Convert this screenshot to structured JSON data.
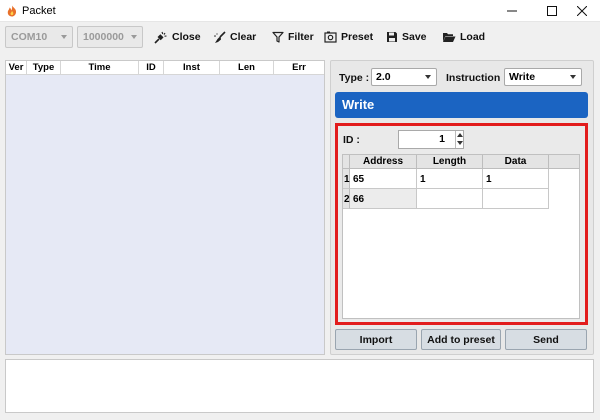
{
  "window": {
    "title": "Packet",
    "accent_color": "#e8702a"
  },
  "toolbar": {
    "port_value": "COM10",
    "baud_value": "1000000",
    "close_label": "Close",
    "clear_label": "Clear",
    "filter_label": "Filter",
    "preset_label": "Preset",
    "save_label": "Save",
    "load_label": "Load"
  },
  "packet_list": {
    "columns": [
      "Ver",
      "Type",
      "Time",
      "ID",
      "Inst",
      "Len",
      "Err"
    ],
    "background": "#e6e9f5"
  },
  "panel": {
    "type_label": "Type :",
    "type_value": "2.0",
    "instruction_label": "Instruction :",
    "instruction_value": "Write",
    "banner": "Write",
    "banner_color": "#1b64c2",
    "highlight_color": "#e21c1c",
    "id_label": "ID :",
    "id_value": "1",
    "grid": {
      "headers": [
        "Address",
        "Length",
        "Data"
      ],
      "rows": [
        {
          "num": "1",
          "address": "65",
          "length": "1",
          "data": "1"
        },
        {
          "num": "2",
          "address": "66",
          "length": "",
          "data": ""
        }
      ]
    },
    "import_label": "Import",
    "add_preset_label": "Add to preset",
    "send_label": "Send"
  }
}
